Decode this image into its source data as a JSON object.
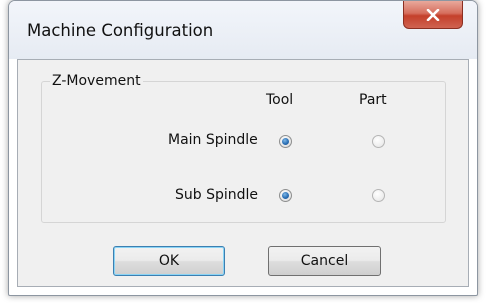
{
  "window": {
    "title": "Machine Configuration",
    "close_icon": "close-icon"
  },
  "group": {
    "legend": "Z-Movement",
    "columns": [
      "Tool",
      "Part"
    ],
    "rows": [
      {
        "label": "Main Spindle",
        "selected": "Tool"
      },
      {
        "label": "Sub Spindle",
        "selected": "Tool"
      }
    ]
  },
  "buttons": {
    "ok_label": "OK",
    "cancel_label": "Cancel"
  }
}
